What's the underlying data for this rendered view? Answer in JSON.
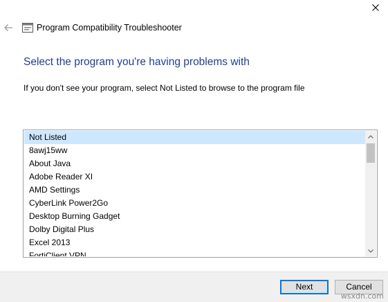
{
  "window": {
    "title": "Program Compatibility Troubleshooter",
    "close_glyph": "✕",
    "back_glyph": "←"
  },
  "content": {
    "heading": "Select the program you're having problems with",
    "subtext": "If you don't see your program, select Not Listed to browse to the program file"
  },
  "program_list": {
    "selected_index": 0,
    "items": [
      "Not Listed",
      "8awj15ww",
      "About Java",
      "Adobe Reader XI",
      "AMD Settings",
      "CyberLink Power2Go",
      "Desktop Burning Gadget",
      "Dolby Digital Plus",
      "Excel 2013",
      "FortiClient VPN"
    ]
  },
  "footer": {
    "next_label": "Next",
    "cancel_label": "Cancel"
  },
  "watermark": "wsxdn.com",
  "icons": {
    "title_icon": "troubleshooter-window-icon",
    "back": "back-arrow-icon",
    "close": "close-icon",
    "scroll_up": "scroll-up-arrow-icon",
    "scroll_down": "scroll-down-arrow-icon"
  },
  "colors": {
    "heading": "#1f3f8e",
    "selection": "#cce8ff",
    "default_button_border": "#0078d7",
    "footer_bg": "#f0f0f0"
  }
}
